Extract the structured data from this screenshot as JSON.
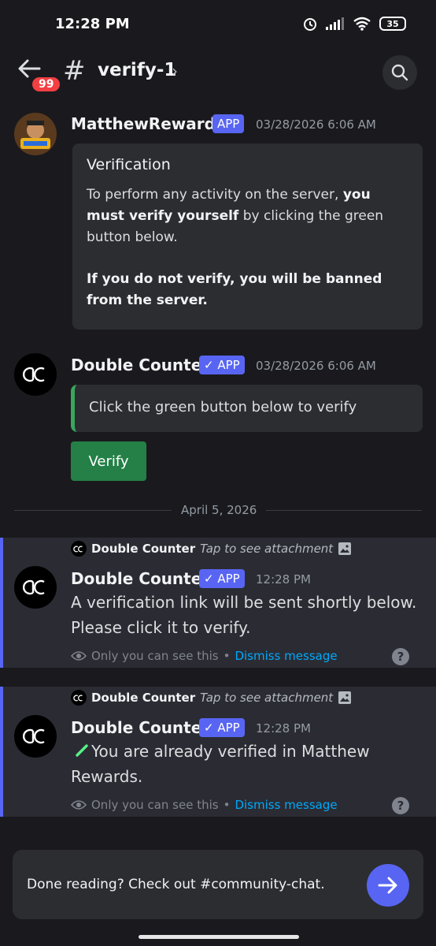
{
  "status": {
    "time": "12:28 PM",
    "battery": "35"
  },
  "header": {
    "badge": "99",
    "hash": "#",
    "channel": "verify-1",
    "chevron": "›"
  },
  "messages": [
    {
      "author": "MatthewRewards",
      "tag": "APP",
      "time": "03/28/2026 6:06 AM",
      "embed_title": "Verification",
      "embed_p1_a": "To perform any activity on the server, ",
      "embed_p1_b": "you must verify yourself",
      "embed_p1_c": " by clicking the green button below.",
      "embed_p2": "If you do not verify, you will be banned from the server."
    },
    {
      "author": "Double Counter",
      "tag": "✓ APP",
      "time": "03/28/2026 6:06 AM",
      "embed_text": "Click the green button below to verify",
      "button": "Verify"
    }
  ],
  "divider": "April 5, 2026",
  "ephemeral": [
    {
      "reply_name": "Double Counter",
      "reply_tap": "Tap to see attachment",
      "author": "Double Counter",
      "tag": "✓ APP",
      "time": "12:28 PM",
      "text_1": "A verification link will be sent shortly below.",
      "text_2": "Please click it to verify.",
      "only_you": "Only you can see this",
      "dot": "•",
      "dismiss": "Dismiss message",
      "help": "?"
    },
    {
      "reply_name": "Double Counter",
      "reply_tap": "Tap to see attachment",
      "author": "Double Counter",
      "tag": "✓ APP",
      "time": "12:28 PM",
      "text_1": "You are already verified in Matthew",
      "text_2": "Rewards.",
      "only_you": "Only you can see this",
      "dot": "•",
      "dismiss": "Dismiss message",
      "help": "?"
    }
  ],
  "bottom": {
    "text": "Done reading? Check out #community-chat."
  },
  "colors": {
    "brand": "#5865f2",
    "verify_green": "#248046",
    "link": "#00a8fc"
  }
}
